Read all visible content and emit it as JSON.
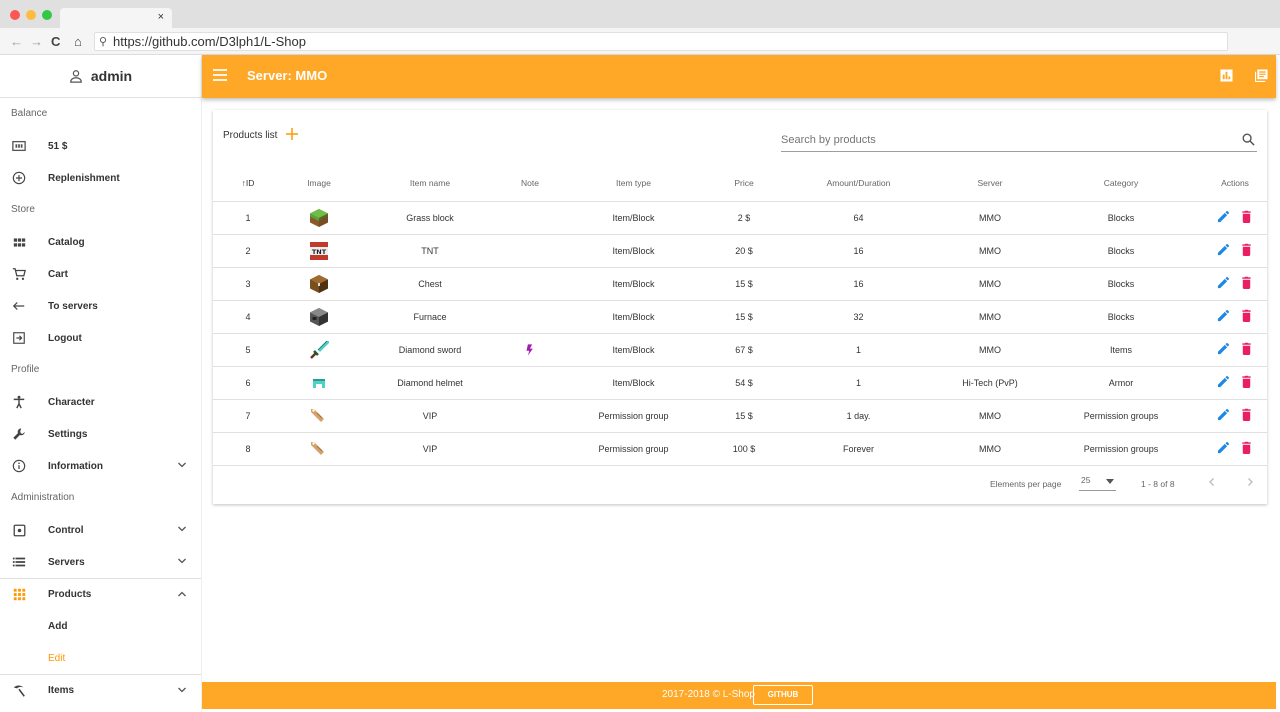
{
  "browser": {
    "tab_close": "×",
    "url": "https://github.com/D3lph1/L-Shop"
  },
  "sidebar": {
    "username": "admin",
    "balance_title": "Balance",
    "balance_value": "51 $",
    "replenishment": "Replenishment",
    "store_title": "Store",
    "catalog": "Catalog",
    "cart": "Cart",
    "to_servers": "To servers",
    "logout": "Logout",
    "profile_title": "Profile",
    "character": "Character",
    "settings": "Settings",
    "information": "Information",
    "admin_title": "Administration",
    "control": "Control",
    "servers": "Servers",
    "products": "Products",
    "add": "Add",
    "edit": "Edit",
    "items": "Items"
  },
  "appbar": {
    "title": "Server: MMO"
  },
  "card": {
    "title": "Products list",
    "search_placeholder": "Search by products"
  },
  "table": {
    "columns": [
      "ID",
      "Image",
      "Item name",
      "Note",
      "Item type",
      "Price",
      "Amount/Duration",
      "Server",
      "Category",
      "Actions"
    ],
    "rows": [
      {
        "id": "1",
        "image": "grass-block-icon",
        "name": "Grass block",
        "note": "",
        "type": "Item/Block",
        "price": "2 $",
        "amount": "64",
        "server": "MMO",
        "category": "Blocks"
      },
      {
        "id": "2",
        "image": "tnt-icon",
        "name": "TNT",
        "note": "",
        "type": "Item/Block",
        "price": "20 $",
        "amount": "16",
        "server": "MMO",
        "category": "Blocks"
      },
      {
        "id": "3",
        "image": "chest-icon",
        "name": "Chest",
        "note": "",
        "type": "Item/Block",
        "price": "15 $",
        "amount": "16",
        "server": "MMO",
        "category": "Blocks"
      },
      {
        "id": "4",
        "image": "furnace-icon",
        "name": "Furnace",
        "note": "",
        "type": "Item/Block",
        "price": "15 $",
        "amount": "32",
        "server": "MMO",
        "category": "Blocks"
      },
      {
        "id": "5",
        "image": "diamond-sword-icon",
        "name": "Diamond sword",
        "note": "enchanted-icon",
        "type": "Item/Block",
        "price": "67 $",
        "amount": "1",
        "server": "MMO",
        "category": "Items"
      },
      {
        "id": "6",
        "image": "diamond-helmet-icon",
        "name": "Diamond helmet",
        "note": "",
        "type": "Item/Block",
        "price": "54 $",
        "amount": "1",
        "server": "Hi-Tech (PvP)",
        "category": "Armor"
      },
      {
        "id": "7",
        "image": "name-tag-icon",
        "name": "VIP",
        "note": "",
        "type": "Permission group",
        "price": "15 $",
        "amount": "1 day.",
        "server": "MMO",
        "category": "Permission groups"
      },
      {
        "id": "8",
        "image": "name-tag-icon",
        "name": "VIP",
        "note": "",
        "type": "Permission group",
        "price": "100 $",
        "amount": "Forever",
        "server": "MMO",
        "category": "Permission groups"
      }
    ]
  },
  "pagination": {
    "label": "Elements per page",
    "per_page": "25",
    "range": "1 - 8 of 8"
  },
  "footer": {
    "text": "2017-2018 © L-Shop",
    "github": "GITHUB"
  },
  "colors": {
    "accent": "#ffa726",
    "edit": "#1e88e5",
    "delete": "#e91e63",
    "active": "#ff9800"
  }
}
